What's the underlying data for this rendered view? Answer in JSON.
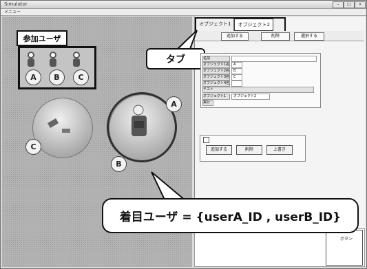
{
  "window": {
    "title": "Simulator",
    "menu": "メニュー"
  },
  "tabs": [
    {
      "label": "オブジェクト1",
      "selected": false
    },
    {
      "label": "オブジェクト2",
      "selected": true
    }
  ],
  "toolbar": {
    "buttons": [
      "追加する",
      "削除",
      "選択する"
    ]
  },
  "form_rows": [
    {
      "label": "名前",
      "value": ""
    },
    {
      "label": "オブジェクト1名",
      "value": "A"
    },
    {
      "label": "オブジェクト2名",
      "value": "B"
    },
    {
      "label": "オブジェクト3名",
      "value": "C"
    },
    {
      "label": "オブジェクト4名",
      "value": ""
    },
    {
      "label": "テスト",
      "value": ""
    },
    {
      "label": "オブジェクト1",
      "value": "オブジェクト2"
    },
    {
      "label": "実行",
      "value": ""
    }
  ],
  "panel_buttons": [
    "追加する",
    "削除",
    "上書き"
  ],
  "side_box": {
    "label": "ボタン"
  },
  "participants_label": "参加ユーザ",
  "participants": [
    "A",
    "B",
    "C"
  ],
  "group_members": [
    "C",
    "A",
    "B"
  ],
  "annotations": {
    "tab": "タブ",
    "focus_user": "着目ユーザ = {userA_ID , userB_ID}"
  }
}
